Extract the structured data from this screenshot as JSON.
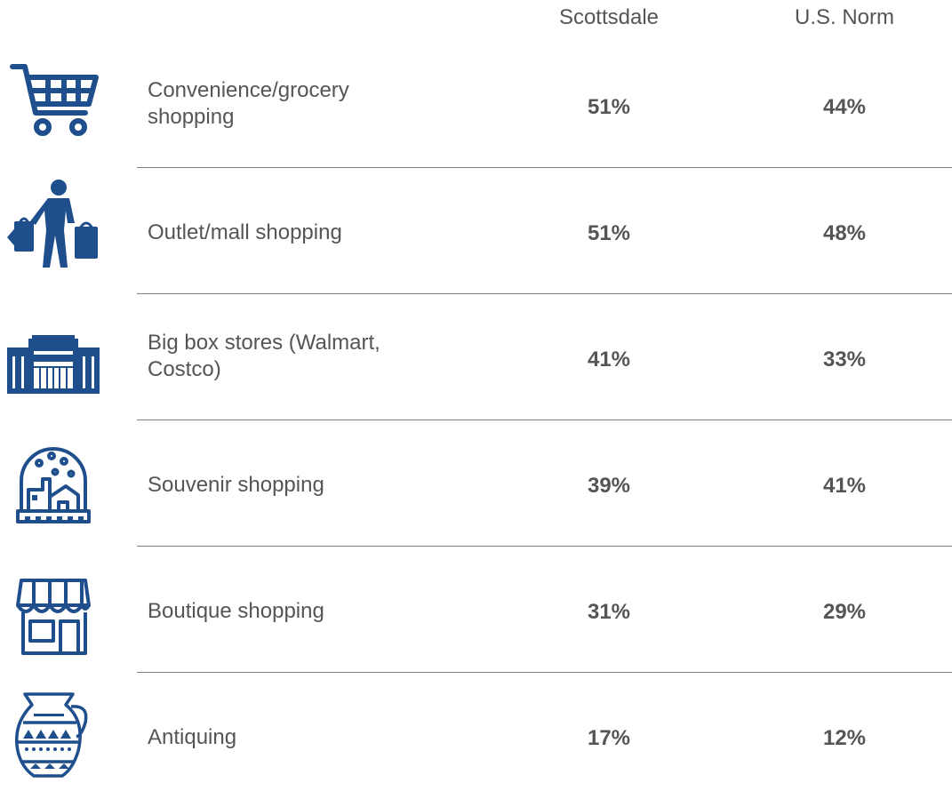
{
  "columns": {
    "scottsdale": "Scottsdale",
    "us_norm": "U.S. Norm"
  },
  "rows": [
    {
      "icon": "shopping-cart-icon",
      "label": "Convenience/grocery shopping",
      "scottsdale": "51%",
      "us_norm": "44%"
    },
    {
      "icon": "shopper-with-bags-icon",
      "label": "Outlet/mall shopping",
      "scottsdale": "51%",
      "us_norm": "48%"
    },
    {
      "icon": "big-box-store-icon",
      "label": "Big box stores (Walmart, Costco)",
      "scottsdale": "41%",
      "us_norm": "33%"
    },
    {
      "icon": "snow-globe-souvenir-icon",
      "label": "Souvenir shopping",
      "scottsdale": "39%",
      "us_norm": "41%"
    },
    {
      "icon": "boutique-storefront-icon",
      "label": "Boutique shopping",
      "scottsdale": "31%",
      "us_norm": "29%"
    },
    {
      "icon": "antique-jug-icon",
      "label": "Antiquing",
      "scottsdale": "17%",
      "us_norm": "12%"
    }
  ],
  "colors": {
    "icon": "#1f4e8c",
    "text": "#555555",
    "separator": "#7f7f7f"
  }
}
